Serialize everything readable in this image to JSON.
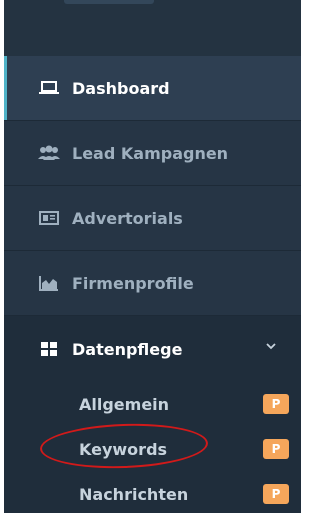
{
  "sidebar": {
    "items": [
      {
        "label": "Dashboard",
        "icon": "laptop-icon",
        "state": "active"
      },
      {
        "label": "Lead Kampagnen",
        "icon": "users-icon",
        "state": "normal"
      },
      {
        "label": "Advertorials",
        "icon": "newspaper-icon",
        "state": "normal"
      },
      {
        "label": "Firmenprofile",
        "icon": "area-chart-icon",
        "state": "normal"
      },
      {
        "label": "Datenpflege",
        "icon": "windows-icon",
        "state": "expanded"
      }
    ],
    "submenu": [
      {
        "label": "Allgemein",
        "badge": "P"
      },
      {
        "label": "Keywords",
        "badge": "P",
        "highlighted": true
      },
      {
        "label": "Nachrichten",
        "badge": "P"
      }
    ]
  },
  "colors": {
    "panel_bg": "#263545",
    "active_bg": "#2e3f52",
    "submenu_bg": "#1f2d3b",
    "badge": "#f5a65b",
    "annotation_circle": "#d11a1a"
  }
}
